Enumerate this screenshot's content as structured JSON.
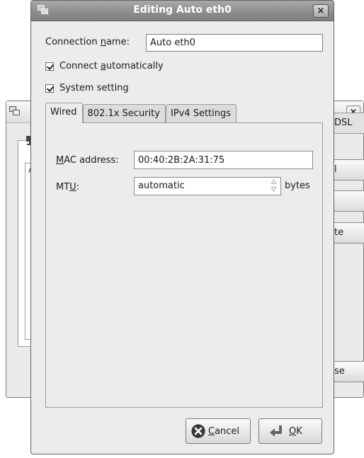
{
  "background_window": {
    "tab_dsl_label": "DSL",
    "list_header": "A",
    "button_edit_label": "l",
    "button_delete_label": "te",
    "button_close_label": "se",
    "close_glyph": "×"
  },
  "dialog": {
    "title": "Editing Auto eth0",
    "close_glyph": "×",
    "connection_name": {
      "label_pre": "Connection ",
      "label_mnemonic": "n",
      "label_post": "ame:",
      "value": "Auto eth0"
    },
    "connect_automatically": {
      "checked": true,
      "label_pre": "Connect ",
      "label_mnemonic": "a",
      "label_post": "utomatically"
    },
    "system_setting": {
      "checked": true,
      "label": "System setting"
    },
    "tabs": [
      {
        "label": "Wired",
        "active": true
      },
      {
        "label": "802.1x Security",
        "active": false
      },
      {
        "label": "IPv4 Settings",
        "active": false
      }
    ],
    "mac_address": {
      "label_mnemonic": "M",
      "label_post": "AC address:",
      "value": "00:40:2B:2A:31:75"
    },
    "mtu": {
      "label_pre": "MT",
      "label_mnemonic": "U",
      "label_post": ":",
      "value": "automatic",
      "unit": "bytes"
    },
    "buttons": {
      "cancel_mnemonic": "C",
      "cancel_rest": "ancel",
      "ok_mnemonic": "O",
      "ok_rest": "K"
    }
  }
}
